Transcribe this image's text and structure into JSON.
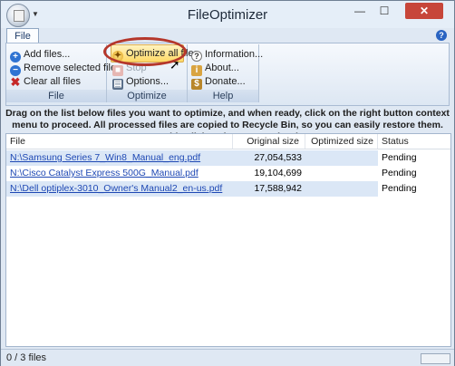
{
  "window": {
    "title": "FileOptimizer",
    "min_glyph": "—",
    "max_glyph": "☐",
    "close_glyph": "✕"
  },
  "tabs": {
    "file": "File",
    "help_glyph": "?"
  },
  "ribbon": {
    "groups": [
      {
        "label": "File",
        "buttons": [
          "Add files...",
          "Remove selected files",
          "Clear all files"
        ]
      },
      {
        "label": "Optimize",
        "buttons": [
          "Optimize all files",
          "Stop",
          "Options..."
        ]
      },
      {
        "label": "Help",
        "buttons": [
          "Information...",
          "About...",
          "Donate..."
        ]
      }
    ]
  },
  "info_text": "Drag on the list below files you want to optimize, and when ready, click on the right button context menu to proceed. All processed files are copied to Recycle Bin, so you can easily restore them. Double click an item to preview it.",
  "list": {
    "columns": [
      "File",
      "Original size",
      "Optimized size",
      "Status"
    ],
    "rows": [
      {
        "file": "N:\\Samsung Series 7_Win8_Manual_eng.pdf",
        "original": "27,054,533",
        "optimized": "",
        "status": "Pending"
      },
      {
        "file": "N:\\Cisco Catalyst Express 500G_Manual.pdf",
        "original": "19,104,699",
        "optimized": "",
        "status": "Pending"
      },
      {
        "file": "N:\\Dell optiplex-3010_Owner's Manual2_en-us.pdf",
        "original": "17,588,942",
        "optimized": "",
        "status": "Pending"
      }
    ]
  },
  "statusbar": {
    "text": "0 / 3 files"
  },
  "colors": {
    "accent": "#1e48b4",
    "selected_row": "#dbe7f6",
    "annotation": "#b5372b"
  }
}
